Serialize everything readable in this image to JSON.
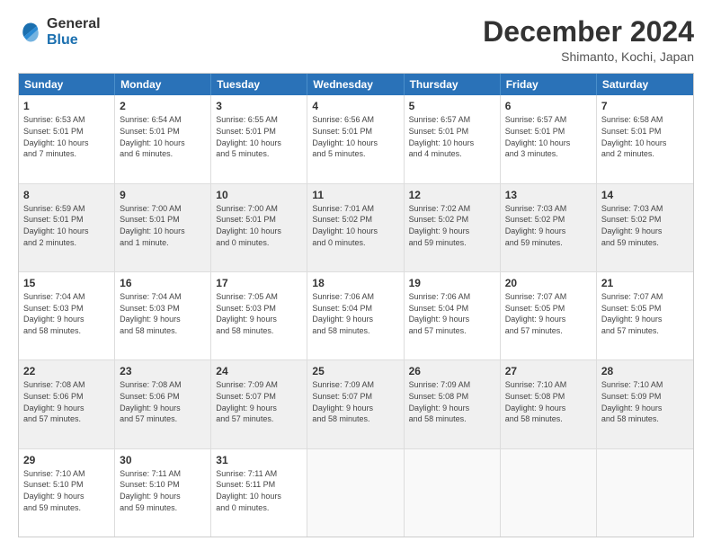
{
  "logo": {
    "general": "General",
    "blue": "Blue"
  },
  "header": {
    "month": "December 2024",
    "location": "Shimanto, Kochi, Japan"
  },
  "days": [
    "Sunday",
    "Monday",
    "Tuesday",
    "Wednesday",
    "Thursday",
    "Friday",
    "Saturday"
  ],
  "rows": [
    [
      {
        "num": "1",
        "lines": [
          "Sunrise: 6:53 AM",
          "Sunset: 5:01 PM",
          "Daylight: 10 hours",
          "and 7 minutes."
        ]
      },
      {
        "num": "2",
        "lines": [
          "Sunrise: 6:54 AM",
          "Sunset: 5:01 PM",
          "Daylight: 10 hours",
          "and 6 minutes."
        ]
      },
      {
        "num": "3",
        "lines": [
          "Sunrise: 6:55 AM",
          "Sunset: 5:01 PM",
          "Daylight: 10 hours",
          "and 5 minutes."
        ]
      },
      {
        "num": "4",
        "lines": [
          "Sunrise: 6:56 AM",
          "Sunset: 5:01 PM",
          "Daylight: 10 hours",
          "and 5 minutes."
        ]
      },
      {
        "num": "5",
        "lines": [
          "Sunrise: 6:57 AM",
          "Sunset: 5:01 PM",
          "Daylight: 10 hours",
          "and 4 minutes."
        ]
      },
      {
        "num": "6",
        "lines": [
          "Sunrise: 6:57 AM",
          "Sunset: 5:01 PM",
          "Daylight: 10 hours",
          "and 3 minutes."
        ]
      },
      {
        "num": "7",
        "lines": [
          "Sunrise: 6:58 AM",
          "Sunset: 5:01 PM",
          "Daylight: 10 hours",
          "and 2 minutes."
        ]
      }
    ],
    [
      {
        "num": "8",
        "lines": [
          "Sunrise: 6:59 AM",
          "Sunset: 5:01 PM",
          "Daylight: 10 hours",
          "and 2 minutes."
        ]
      },
      {
        "num": "9",
        "lines": [
          "Sunrise: 7:00 AM",
          "Sunset: 5:01 PM",
          "Daylight: 10 hours",
          "and 1 minute."
        ]
      },
      {
        "num": "10",
        "lines": [
          "Sunrise: 7:00 AM",
          "Sunset: 5:01 PM",
          "Daylight: 10 hours",
          "and 0 minutes."
        ]
      },
      {
        "num": "11",
        "lines": [
          "Sunrise: 7:01 AM",
          "Sunset: 5:02 PM",
          "Daylight: 10 hours",
          "and 0 minutes."
        ]
      },
      {
        "num": "12",
        "lines": [
          "Sunrise: 7:02 AM",
          "Sunset: 5:02 PM",
          "Daylight: 9 hours",
          "and 59 minutes."
        ]
      },
      {
        "num": "13",
        "lines": [
          "Sunrise: 7:03 AM",
          "Sunset: 5:02 PM",
          "Daylight: 9 hours",
          "and 59 minutes."
        ]
      },
      {
        "num": "14",
        "lines": [
          "Sunrise: 7:03 AM",
          "Sunset: 5:02 PM",
          "Daylight: 9 hours",
          "and 59 minutes."
        ]
      }
    ],
    [
      {
        "num": "15",
        "lines": [
          "Sunrise: 7:04 AM",
          "Sunset: 5:03 PM",
          "Daylight: 9 hours",
          "and 58 minutes."
        ]
      },
      {
        "num": "16",
        "lines": [
          "Sunrise: 7:04 AM",
          "Sunset: 5:03 PM",
          "Daylight: 9 hours",
          "and 58 minutes."
        ]
      },
      {
        "num": "17",
        "lines": [
          "Sunrise: 7:05 AM",
          "Sunset: 5:03 PM",
          "Daylight: 9 hours",
          "and 58 minutes."
        ]
      },
      {
        "num": "18",
        "lines": [
          "Sunrise: 7:06 AM",
          "Sunset: 5:04 PM",
          "Daylight: 9 hours",
          "and 58 minutes."
        ]
      },
      {
        "num": "19",
        "lines": [
          "Sunrise: 7:06 AM",
          "Sunset: 5:04 PM",
          "Daylight: 9 hours",
          "and 57 minutes."
        ]
      },
      {
        "num": "20",
        "lines": [
          "Sunrise: 7:07 AM",
          "Sunset: 5:05 PM",
          "Daylight: 9 hours",
          "and 57 minutes."
        ]
      },
      {
        "num": "21",
        "lines": [
          "Sunrise: 7:07 AM",
          "Sunset: 5:05 PM",
          "Daylight: 9 hours",
          "and 57 minutes."
        ]
      }
    ],
    [
      {
        "num": "22",
        "lines": [
          "Sunrise: 7:08 AM",
          "Sunset: 5:06 PM",
          "Daylight: 9 hours",
          "and 57 minutes."
        ]
      },
      {
        "num": "23",
        "lines": [
          "Sunrise: 7:08 AM",
          "Sunset: 5:06 PM",
          "Daylight: 9 hours",
          "and 57 minutes."
        ]
      },
      {
        "num": "24",
        "lines": [
          "Sunrise: 7:09 AM",
          "Sunset: 5:07 PM",
          "Daylight: 9 hours",
          "and 57 minutes."
        ]
      },
      {
        "num": "25",
        "lines": [
          "Sunrise: 7:09 AM",
          "Sunset: 5:07 PM",
          "Daylight: 9 hours",
          "and 58 minutes."
        ]
      },
      {
        "num": "26",
        "lines": [
          "Sunrise: 7:09 AM",
          "Sunset: 5:08 PM",
          "Daylight: 9 hours",
          "and 58 minutes."
        ]
      },
      {
        "num": "27",
        "lines": [
          "Sunrise: 7:10 AM",
          "Sunset: 5:08 PM",
          "Daylight: 9 hours",
          "and 58 minutes."
        ]
      },
      {
        "num": "28",
        "lines": [
          "Sunrise: 7:10 AM",
          "Sunset: 5:09 PM",
          "Daylight: 9 hours",
          "and 58 minutes."
        ]
      }
    ],
    [
      {
        "num": "29",
        "lines": [
          "Sunrise: 7:10 AM",
          "Sunset: 5:10 PM",
          "Daylight: 9 hours",
          "and 59 minutes."
        ]
      },
      {
        "num": "30",
        "lines": [
          "Sunrise: 7:11 AM",
          "Sunset: 5:10 PM",
          "Daylight: 9 hours",
          "and 59 minutes."
        ]
      },
      {
        "num": "31",
        "lines": [
          "Sunrise: 7:11 AM",
          "Sunset: 5:11 PM",
          "Daylight: 10 hours",
          "and 0 minutes."
        ]
      },
      {
        "num": "",
        "lines": []
      },
      {
        "num": "",
        "lines": []
      },
      {
        "num": "",
        "lines": []
      },
      {
        "num": "",
        "lines": []
      }
    ]
  ]
}
